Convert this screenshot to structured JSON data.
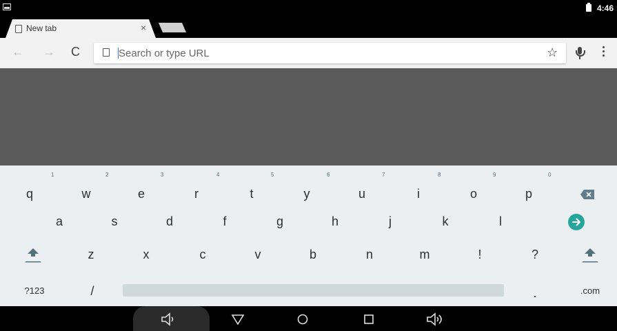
{
  "status_bar": {
    "time": "4:46",
    "notification_icon": "image-notification-icon",
    "battery_icon": "battery-icon"
  },
  "tabs": [
    {
      "title": "New tab",
      "close": "×"
    }
  ],
  "toolbar": {
    "back": "←",
    "forward": "→",
    "reload": "C",
    "star": "☆",
    "menu": "⋮"
  },
  "omnibox": {
    "placeholder": "Search or type URL",
    "value": ""
  },
  "keyboard": {
    "row1": [
      {
        "k": "q",
        "h": "1"
      },
      {
        "k": "w",
        "h": "2"
      },
      {
        "k": "e",
        "h": "3"
      },
      {
        "k": "r",
        "h": "4"
      },
      {
        "k": "t",
        "h": "5"
      },
      {
        "k": "y",
        "h": "6"
      },
      {
        "k": "u",
        "h": "7"
      },
      {
        "k": "i",
        "h": "8"
      },
      {
        "k": "o",
        "h": "9"
      },
      {
        "k": "p",
        "h": "0"
      }
    ],
    "row2": [
      "a",
      "s",
      "d",
      "f",
      "g",
      "h",
      "j",
      "k",
      "l"
    ],
    "row3": [
      "z",
      "x",
      "c",
      "v",
      "b",
      "n",
      "m",
      "!",
      "?"
    ],
    "row4": {
      "symbols": "?123",
      "slash": "/",
      "period": ".",
      "com": ".com"
    },
    "enter_color": "#26a69a"
  },
  "nav": {
    "volume_down": "volume-down-icon",
    "back": "back-icon",
    "home": "home-icon",
    "recents": "recents-icon",
    "volume_up": "volume-up-icon"
  }
}
